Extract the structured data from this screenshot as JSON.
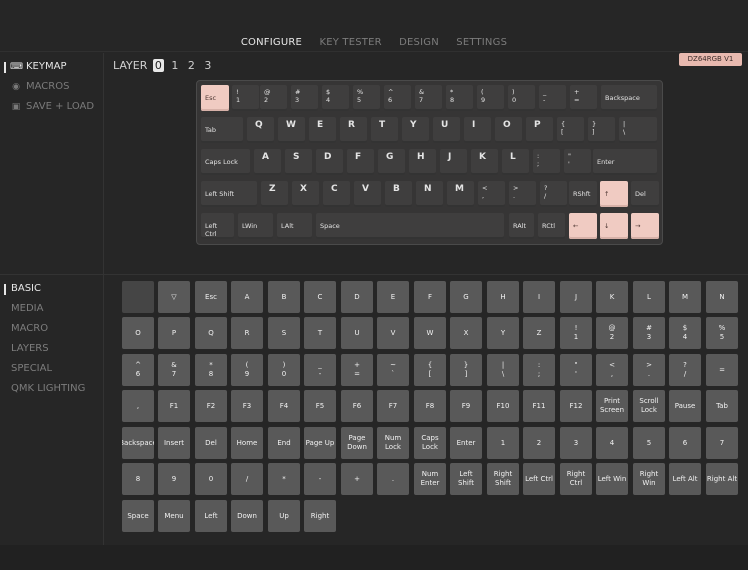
{
  "tabs": [
    "CONFIGURE",
    "KEY TESTER",
    "DESIGN",
    "SETTINGS"
  ],
  "sidebar": {
    "items": [
      {
        "label": "KEYMAP",
        "icon": "keyboard-icon",
        "glyph": "⌨"
      },
      {
        "label": "MACROS",
        "icon": "macro-icon",
        "glyph": "◉"
      },
      {
        "label": "SAVE + LOAD",
        "icon": "save-icon",
        "glyph": "▣"
      }
    ]
  },
  "layer": {
    "label": "LAYER",
    "layers": [
      "0",
      "1",
      "2",
      "3"
    ],
    "selected": "0"
  },
  "device_badge": "DZ64RGB V1",
  "keyboard_rows": [
    [
      {
        "l": "Esc",
        "t": "mod",
        "p": 1
      },
      {
        "l": "!\n1"
      },
      {
        "l": "@\n2"
      },
      {
        "l": "#\n3"
      },
      {
        "l": "$\n4"
      },
      {
        "l": "%\n5"
      },
      {
        "l": "^\n6"
      },
      {
        "l": "&\n7"
      },
      {
        "l": "*\n8"
      },
      {
        "l": "(\n9"
      },
      {
        "l": ")\n0"
      },
      {
        "l": "_\n-"
      },
      {
        "l": "+\n="
      },
      {
        "l": "Backspace",
        "t": "mod"
      }
    ],
    [
      {
        "l": "Tab",
        "t": "mod"
      },
      {
        "l": "Q",
        "t": "alpha"
      },
      {
        "l": "W",
        "t": "alpha"
      },
      {
        "l": "E",
        "t": "alpha"
      },
      {
        "l": "R",
        "t": "alpha"
      },
      {
        "l": "T",
        "t": "alpha"
      },
      {
        "l": "Y",
        "t": "alpha"
      },
      {
        "l": "U",
        "t": "alpha"
      },
      {
        "l": "I",
        "t": "alpha"
      },
      {
        "l": "O",
        "t": "alpha"
      },
      {
        "l": "P",
        "t": "alpha"
      },
      {
        "l": "{\n["
      },
      {
        "l": "}\n]"
      },
      {
        "l": "|\n\\"
      }
    ],
    [
      {
        "l": "Caps Lock",
        "t": "mod"
      },
      {
        "l": "A",
        "t": "alpha"
      },
      {
        "l": "S",
        "t": "alpha"
      },
      {
        "l": "D",
        "t": "alpha"
      },
      {
        "l": "F",
        "t": "alpha"
      },
      {
        "l": "G",
        "t": "alpha"
      },
      {
        "l": "H",
        "t": "alpha"
      },
      {
        "l": "J",
        "t": "alpha"
      },
      {
        "l": "K",
        "t": "alpha"
      },
      {
        "l": "L",
        "t": "alpha"
      },
      {
        "l": ":\n;"
      },
      {
        "l": "\"\n'"
      },
      {
        "l": "Enter",
        "t": "mod"
      }
    ],
    [
      {
        "l": "Left Shift",
        "t": "mod"
      },
      {
        "l": "Z",
        "t": "alpha"
      },
      {
        "l": "X",
        "t": "alpha"
      },
      {
        "l": "C",
        "t": "alpha"
      },
      {
        "l": "V",
        "t": "alpha"
      },
      {
        "l": "B",
        "t": "alpha"
      },
      {
        "l": "N",
        "t": "alpha"
      },
      {
        "l": "M",
        "t": "alpha"
      },
      {
        "l": "<\n,"
      },
      {
        "l": ">\n."
      },
      {
        "l": "?\n/"
      },
      {
        "l": "RShft",
        "t": "mod"
      },
      {
        "l": "↑",
        "t": "mod",
        "p": 1
      },
      {
        "l": "Del",
        "t": "mod"
      }
    ],
    [
      {
        "l": "Left Ctrl",
        "t": "mod"
      },
      {
        "l": "LWin",
        "t": "mod"
      },
      {
        "l": "LAlt",
        "t": "mod"
      },
      {
        "l": "Space",
        "t": "mod"
      },
      {
        "l": "RAlt",
        "t": "mod"
      },
      {
        "l": "RCtl",
        "t": "mod"
      },
      {
        "l": "←",
        "t": "mod",
        "p": 1
      },
      {
        "l": "↓",
        "t": "mod",
        "p": 1
      },
      {
        "l": "→",
        "t": "mod",
        "p": 1
      }
    ]
  ],
  "categories": [
    "BASIC",
    "MEDIA",
    "MACRO",
    "LAYERS",
    "SPECIAL",
    "QMK LIGHTING"
  ],
  "active_category": "BASIC",
  "basic_keys": [
    "",
    "▽",
    "Esc",
    "A",
    "B",
    "C",
    "D",
    "E",
    "F",
    "G",
    "H",
    "I",
    "J",
    "K",
    "L",
    "M",
    "N",
    "O",
    "P",
    "Q",
    "R",
    "S",
    "T",
    "U",
    "V",
    "W",
    "X",
    "Y",
    "Z",
    "!\n1",
    "@\n2",
    "#\n3",
    "$\n4",
    "%\n5",
    "^\n6",
    "&\n7",
    "*\n8",
    "(\n9",
    ")\n0",
    "_\n-",
    "+\n=",
    "~\n`",
    "{\n[",
    "}\n]",
    "|\n\\",
    ":\n;",
    "\"\n'",
    "<\n,",
    ">\n.",
    "?\n/",
    "=",
    ",",
    "F1",
    "F2",
    "F3",
    "F4",
    "F5",
    "F6",
    "F7",
    "F8",
    "F9",
    "F10",
    "F11",
    "F12",
    "Print\nScreen",
    "Scroll\nLock",
    "Pause",
    "Tab",
    "Backspace",
    "Insert",
    "Del",
    "Home",
    "End",
    "Page Up",
    "Page\nDown",
    "Num\nLock",
    "Caps\nLock",
    "Enter",
    "1",
    "2",
    "3",
    "4",
    "5",
    "6",
    "7",
    "8",
    "9",
    "0",
    "/",
    "*",
    "-",
    "+",
    ".",
    "Num\nEnter",
    "Left\nShift",
    "Right\nShift",
    "Left Ctrl",
    "Right\nCtrl",
    "Left Win",
    "Right\nWin",
    "Left Alt",
    "Right Alt",
    "Space",
    "Menu",
    "Left",
    "Down",
    "Up",
    "Right"
  ],
  "colors": {
    "accent": "#f0cbc2",
    "badge": "#e8b9af",
    "key": "#595959",
    "background": "#262626"
  }
}
